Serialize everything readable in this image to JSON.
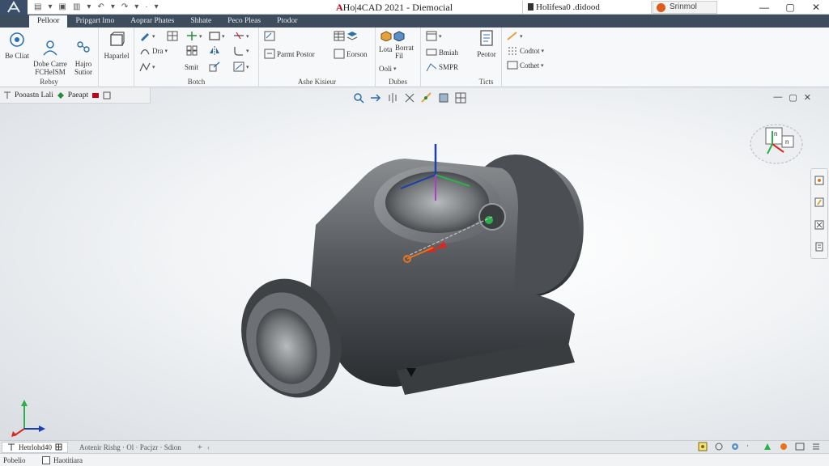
{
  "titlebar": {
    "app_name": "Ho|4CAD 2021 - Diemocial",
    "brand": "A",
    "tab_title": "Holifesa0 .didood",
    "user": "Srinmol",
    "qa_labels": [
      "▾",
      "▾",
      "▾",
      "▾",
      "·",
      "▾"
    ]
  },
  "window_controls": {
    "minimize": "—",
    "maximize": "▢",
    "close": "✕"
  },
  "ribbon": {
    "tabs": [
      {
        "label": "Pelloor",
        "active": true
      },
      {
        "label": "Pripgart lmo",
        "active": false
      },
      {
        "label": "Aoprar Phates",
        "active": false
      },
      {
        "label": "Shhate",
        "active": false
      },
      {
        "label": "Peco Pleas",
        "active": false
      },
      {
        "label": "Ptodor",
        "active": false
      }
    ],
    "groups": [
      {
        "label": "Rebsy",
        "buttons": [
          "Be Cliat",
          "Dobe Carre\nFCHeISM",
          "Hajro\nSutior"
        ]
      },
      {
        "label": "",
        "buttons": [
          "Haparlel"
        ]
      },
      {
        "label": "Botch",
        "buttons": [
          "Dra",
          "Smit"
        ]
      },
      {
        "label": "Ashe Kisieur",
        "buttons": [
          "Parmt Postor",
          "Eorson"
        ]
      },
      {
        "label": "Dubes",
        "buttons": [
          "Lota",
          "Borrat\nFil",
          "Ooli",
          "Bmiah",
          "SMPR"
        ]
      },
      {
        "label": "Ticts",
        "buttons": [
          "Peotor"
        ]
      },
      {
        "label": "",
        "buttons": [
          "Codtot",
          "Cothet"
        ]
      }
    ]
  },
  "viewport": {
    "toolbar_label": "Pooastn Lali",
    "toolbar_mode": "Paeapt",
    "viewcube_top": "n",
    "viewcube_right": "n",
    "vp_controls": [
      "—",
      "▢",
      "✕"
    ]
  },
  "tabbar": {
    "model_tab": "Hetrlohd40",
    "layout_tabs": "Aotenir Rishg · Ol · Pacjzr · Sdion",
    "add": "+",
    "arrow": "‹"
  },
  "statusbar": {
    "left": "Pobelio",
    "model": "Haotitiara"
  },
  "colors": {
    "titlebar_bg": "#ffffff",
    "ribbon_tabs_bg": "#3d4d5e",
    "accent_red": "#c2001b",
    "axis_x": "#d62a20",
    "axis_y": "#2bb04a",
    "axis_z": "#1c3fae"
  }
}
